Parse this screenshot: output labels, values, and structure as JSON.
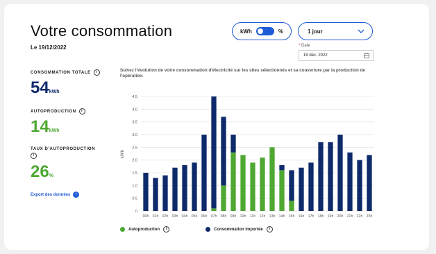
{
  "header": {
    "title": "Votre consommation",
    "date": "Le 19/12/2022"
  },
  "controls": {
    "unit_left": "kWh",
    "unit_right": "%",
    "period": "1 jour",
    "date_label": "Date",
    "date_required_mark": "*",
    "date_value": "19 déc. 2022"
  },
  "kpis": {
    "total_label": "CONSOMMATION TOTALE",
    "total_value": "54",
    "total_unit": "kWh",
    "auto_label": "AUTOPRODUCTION",
    "auto_value": "14",
    "auto_unit": "kWh",
    "rate_label": "TAUX D'AUTOPRODUCTION",
    "rate_value": "26",
    "rate_unit": "%"
  },
  "export_label": "Export des données",
  "description": "Suivez l'évolution de votre consommation d'électricité sur les sites sélectionnés et sa couverture par la production de l'opération.",
  "colors": {
    "accent": "#1e5bd6",
    "imported": "#0e2a6b",
    "autoproduction": "#4ea832"
  },
  "chart_data": {
    "type": "bar",
    "stacked": true,
    "ylabel": "kWh",
    "ylim": [
      0,
      4.5
    ],
    "yticks": [
      "0",
      "0.5",
      "1.0",
      "1.5",
      "2.0",
      "2.5",
      "3.0",
      "3.5",
      "4.0",
      "4.5"
    ],
    "categories": [
      "00h",
      "01h",
      "02h",
      "03h",
      "04h",
      "05h",
      "06h",
      "07h",
      "08h",
      "09h",
      "10h",
      "11h",
      "12h",
      "13h",
      "14h",
      "15h",
      "16h",
      "17h",
      "18h",
      "19h",
      "20h",
      "21h",
      "22h",
      "23h"
    ],
    "series": [
      {
        "name": "Autoproduction",
        "color": "#4ea832",
        "values": [
          0,
          0,
          0,
          0,
          0,
          0,
          0,
          0.1,
          1.0,
          2.3,
          2.2,
          1.9,
          2.1,
          2.5,
          1.6,
          0.4,
          0,
          0,
          0,
          0,
          0,
          0,
          0,
          0
        ]
      },
      {
        "name": "Consommation importée",
        "color": "#0e2a6b",
        "values": [
          1.5,
          1.3,
          1.4,
          1.7,
          1.8,
          1.9,
          3.0,
          4.4,
          2.7,
          0.7,
          0,
          0,
          0,
          0,
          0.2,
          1.2,
          1.7,
          1.9,
          2.7,
          2.7,
          3.0,
          2.3,
          2.0,
          2.2
        ]
      }
    ],
    "grid": true,
    "legend_position": "bottom"
  }
}
